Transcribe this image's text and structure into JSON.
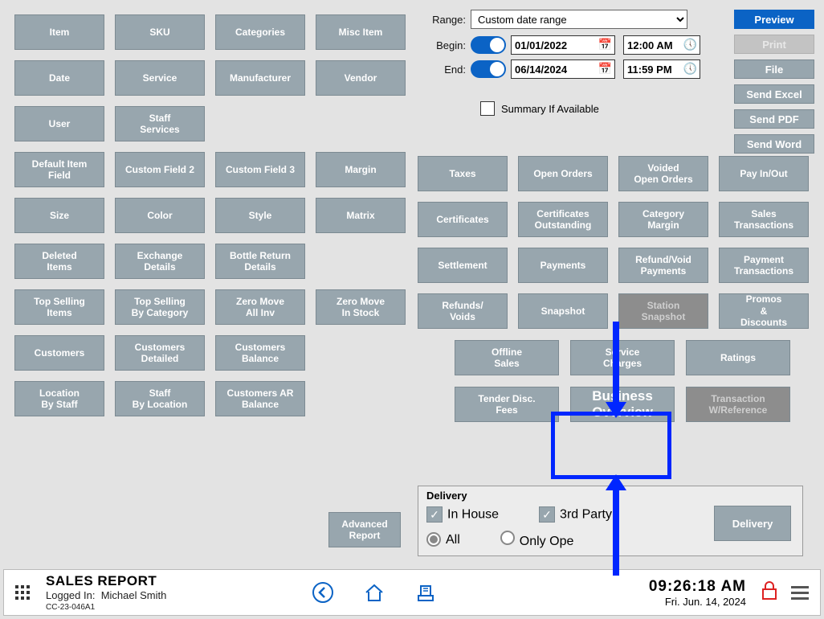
{
  "range": {
    "label": "Range:",
    "value": "Custom date range"
  },
  "begin": {
    "label": "Begin:",
    "date": "01/01/2022",
    "time": "12:00 AM"
  },
  "end": {
    "label": "End:",
    "date": "06/14/2024",
    "time": "11:59 PM"
  },
  "summary_label": "Summary If Available",
  "actions": {
    "preview": "Preview",
    "print": "Print",
    "file": "File",
    "excel": "Send Excel",
    "pdf": "Send PDF",
    "word": "Send Word"
  },
  "left_tiles": [
    "Item",
    "SKU",
    "Categories",
    "Misc Item",
    "Date",
    "Service",
    "Manufacturer",
    "Vendor",
    "User",
    "Staff\nServices",
    "",
    "",
    "Default Item\nField",
    "Custom Field 2",
    "Custom Field 3",
    "Margin",
    "Size",
    "Color",
    "Style",
    "Matrix",
    "Deleted\nItems",
    "Exchange\nDetails",
    "Bottle Return\nDetails",
    "",
    "Top Selling\nItems",
    "Top Selling\nBy Category",
    "Zero Move\nAll Inv",
    "Zero Move\nIn Stock",
    "Customers",
    "Customers\nDetailed",
    "Customers\nBalance",
    "",
    "Location\nBy Staff",
    "Staff\nBy Location",
    "Customers AR\nBalance",
    ""
  ],
  "advanced": "Advanced\nReport",
  "right_tiles1": [
    "Taxes",
    "Open Orders",
    "Voided\nOpen Orders",
    "Pay In/Out",
    "Certificates",
    "Certificates\nOutstanding",
    "Category\nMargin",
    "Sales\nTransactions",
    "Settlement",
    "Payments",
    "Refund/Void\nPayments",
    "Payment\nTransactions",
    "Refunds/\nVoids",
    "Snapshot",
    "Station\nSnapshot",
    "Promos\n&\nDiscounts"
  ],
  "right_tiles2": [
    "Offline\nSales",
    "Service\nCharges",
    "Ratings",
    "Tender Disc.\nFees",
    "Business\nOverview",
    "Transaction\nW/Reference"
  ],
  "delivery": {
    "title": "Delivery",
    "inhouse": "In House",
    "thirdparty": "3rd Party",
    "all": "All",
    "onlyopen": "Only Ope",
    "button": "Delivery"
  },
  "footer": {
    "title": "SALES REPORT",
    "logged": "Logged In:",
    "user": "Michael Smith",
    "station": "CC-23-046A1",
    "time": "09:26:18 AM",
    "date": "Fri. Jun. 14, 2024"
  }
}
